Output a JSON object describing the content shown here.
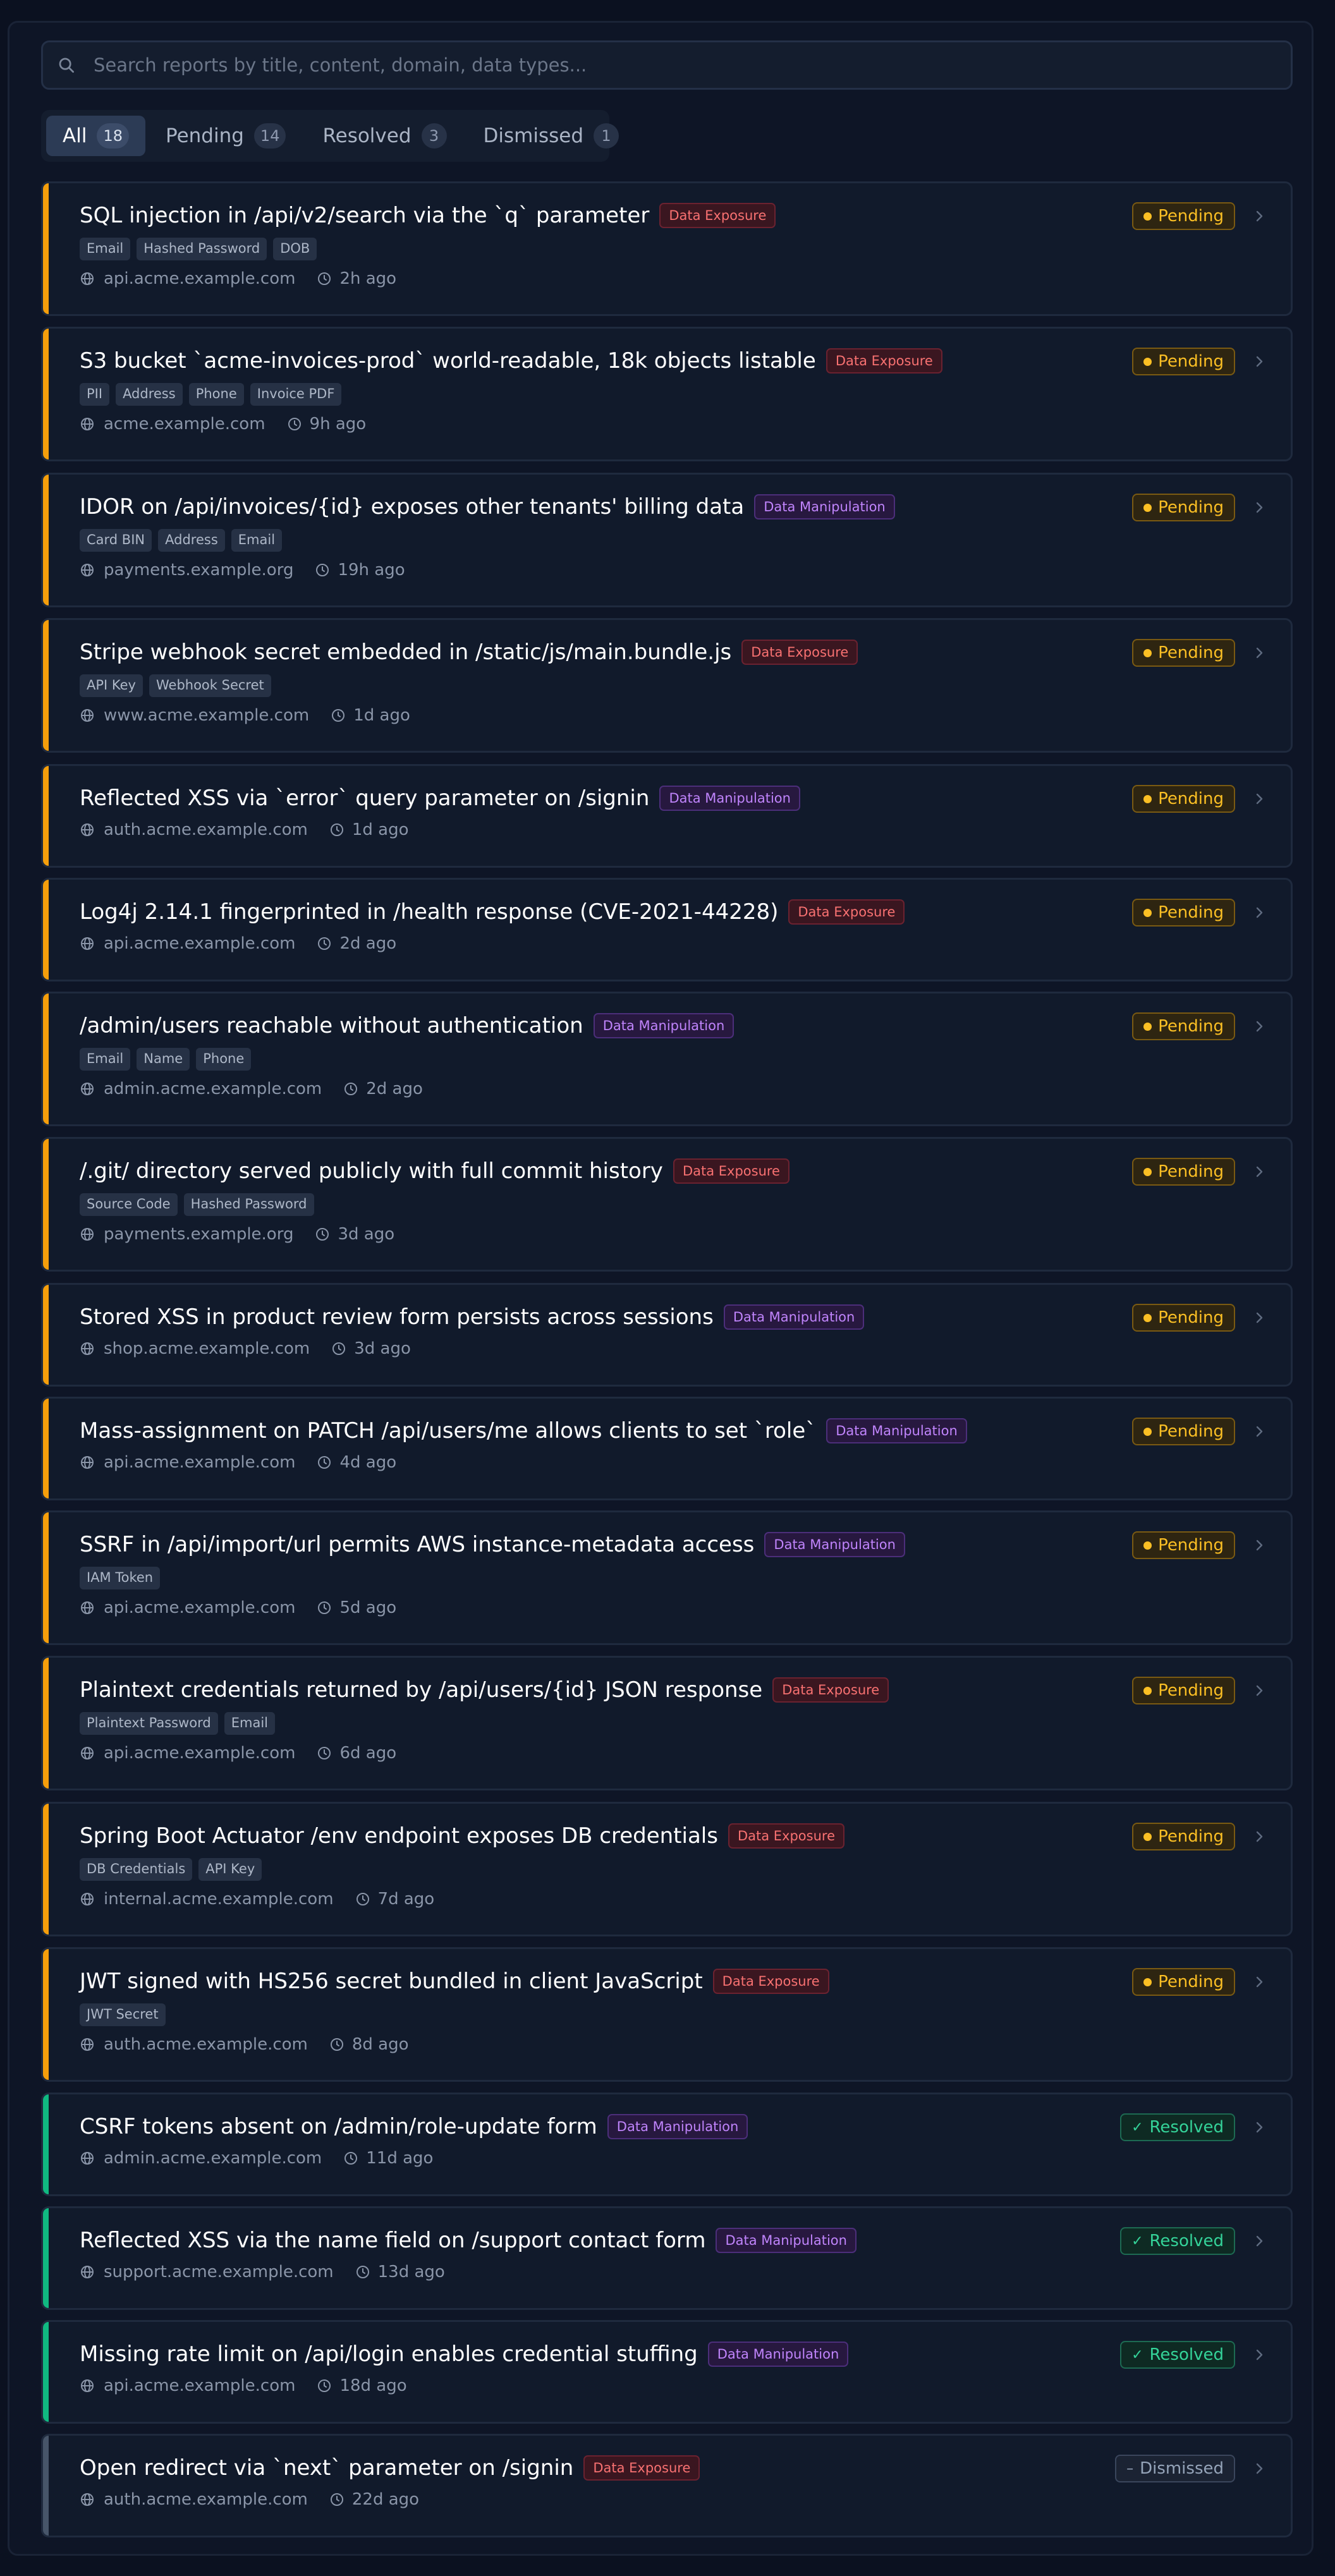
{
  "search": {
    "placeholder": "Search reports by title, content, domain, data types..."
  },
  "tabs": [
    {
      "label": "All",
      "count": "18"
    },
    {
      "label": "Pending",
      "count": "14"
    },
    {
      "label": "Resolved",
      "count": "3"
    },
    {
      "label": "Dismissed",
      "count": "1"
    }
  ],
  "colors": {
    "pending_accent": "#f59e0b",
    "resolved_accent": "#10b981",
    "dismissed_accent": "#475569"
  },
  "reports": [
    {
      "title": "SQL injection in /api/v2/search via the `q` parameter",
      "category": "Data Exposure",
      "tags": [
        "Email",
        "Hashed Password",
        "DOB"
      ],
      "domain": "api.acme.example.com",
      "time": "2h ago",
      "status": "Pending"
    },
    {
      "title": "S3 bucket `acme-invoices-prod` world-readable, 18k objects listable",
      "category": "Data Exposure",
      "tags": [
        "PII",
        "Address",
        "Phone",
        "Invoice PDF"
      ],
      "domain": "acme.example.com",
      "time": "9h ago",
      "status": "Pending"
    },
    {
      "title": "IDOR on /api/invoices/{id} exposes other tenants' billing data",
      "category": "Data Manipulation",
      "tags": [
        "Card BIN",
        "Address",
        "Email"
      ],
      "domain": "payments.example.org",
      "time": "19h ago",
      "status": "Pending"
    },
    {
      "title": "Stripe webhook secret embedded in /static/js/main.bundle.js",
      "category": "Data Exposure",
      "tags": [
        "API Key",
        "Webhook Secret"
      ],
      "domain": "www.acme.example.com",
      "time": "1d ago",
      "status": "Pending"
    },
    {
      "title": "Reflected XSS via `error` query parameter on /signin",
      "category": "Data Manipulation",
      "tags": [],
      "domain": "auth.acme.example.com",
      "time": "1d ago",
      "status": "Pending"
    },
    {
      "title": "Log4j 2.14.1 fingerprinted in /health response (CVE-2021-44228)",
      "category": "Data Exposure",
      "tags": [],
      "domain": "api.acme.example.com",
      "time": "2d ago",
      "status": "Pending"
    },
    {
      "title": "/admin/users reachable without authentication",
      "category": "Data Manipulation",
      "tags": [
        "Email",
        "Name",
        "Phone"
      ],
      "domain": "admin.acme.example.com",
      "time": "2d ago",
      "status": "Pending"
    },
    {
      "title": "/.git/ directory served publicly with full commit history",
      "category": "Data Exposure",
      "tags": [
        "Source Code",
        "Hashed Password"
      ],
      "domain": "payments.example.org",
      "time": "3d ago",
      "status": "Pending"
    },
    {
      "title": "Stored XSS in product review form persists across sessions",
      "category": "Data Manipulation",
      "tags": [],
      "domain": "shop.acme.example.com",
      "time": "3d ago",
      "status": "Pending"
    },
    {
      "title": "Mass-assignment on PATCH /api/users/me allows clients to set `role`",
      "category": "Data Manipulation",
      "tags": [],
      "domain": "api.acme.example.com",
      "time": "4d ago",
      "status": "Pending"
    },
    {
      "title": "SSRF in /api/import/url permits AWS instance-metadata access",
      "category": "Data Manipulation",
      "tags": [
        "IAM Token"
      ],
      "domain": "api.acme.example.com",
      "time": "5d ago",
      "status": "Pending"
    },
    {
      "title": "Plaintext credentials returned by /api/users/{id} JSON response",
      "category": "Data Exposure",
      "tags": [
        "Plaintext Password",
        "Email"
      ],
      "domain": "api.acme.example.com",
      "time": "6d ago",
      "status": "Pending"
    },
    {
      "title": "Spring Boot Actuator /env endpoint exposes DB credentials",
      "category": "Data Exposure",
      "tags": [
        "DB Credentials",
        "API Key"
      ],
      "domain": "internal.acme.example.com",
      "time": "7d ago",
      "status": "Pending"
    },
    {
      "title": "JWT signed with HS256 secret bundled in client JavaScript",
      "category": "Data Exposure",
      "tags": [
        "JWT Secret"
      ],
      "domain": "auth.acme.example.com",
      "time": "8d ago",
      "status": "Pending"
    },
    {
      "title": "CSRF tokens absent on /admin/role-update form",
      "category": "Data Manipulation",
      "tags": [],
      "domain": "admin.acme.example.com",
      "time": "11d ago",
      "status": "Resolved"
    },
    {
      "title": "Reflected XSS via the name field on /support contact form",
      "category": "Data Manipulation",
      "tags": [],
      "domain": "support.acme.example.com",
      "time": "13d ago",
      "status": "Resolved"
    },
    {
      "title": "Missing rate limit on /api/login enables credential stuffing",
      "category": "Data Manipulation",
      "tags": [],
      "domain": "api.acme.example.com",
      "time": "18d ago",
      "status": "Resolved"
    },
    {
      "title": "Open redirect via `next` parameter on /signin",
      "category": "Data Exposure",
      "tags": [],
      "domain": "auth.acme.example.com",
      "time": "22d ago",
      "status": "Dismissed"
    }
  ]
}
